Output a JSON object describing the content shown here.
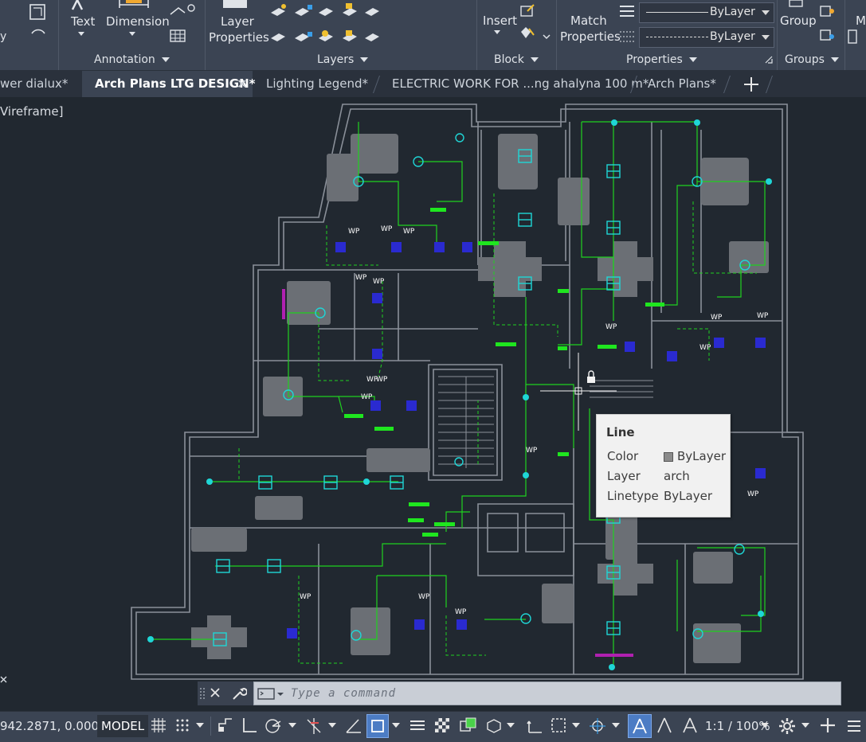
{
  "ribbon": {
    "text_label": "Text",
    "dimension_label": "Dimension",
    "layer_properties_line1": "Layer",
    "layer_properties_line2": "Properties",
    "insert_label": "Insert",
    "match_properties_line1": "Match",
    "match_properties_line2": "Properties",
    "bylayer_1": "ByLayer",
    "bylayer_2": "ByLayer",
    "group_label": "Group",
    "more_label": "M",
    "panels": [
      "Annotation",
      "Layers",
      "Block",
      "Properties",
      "Groups"
    ]
  },
  "tabs": [
    {
      "label": "wer dialux*"
    },
    {
      "label": "Arch Plans LTG DESIGN*",
      "active": true
    },
    {
      "label": "Lighting Legend*"
    },
    {
      "label": "ELECTRIC WORK FOR ...ng ahalyna 100 m*"
    },
    {
      "label": "Arch Plans*"
    }
  ],
  "viewport": {
    "label": "Vireframe]"
  },
  "tooltip": {
    "title": "Line",
    "color_key": "Color",
    "color_val": "ByLayer",
    "layer_key": "Layer",
    "layer_val": "arch",
    "linetype_key": "Linetype",
    "linetype_val": "ByLayer"
  },
  "command": {
    "placeholder": "Type a command"
  },
  "status": {
    "coords": "942.2871, 0.0000",
    "model": "MODEL",
    "scale": "1:1 / 100%"
  },
  "colors": {
    "ribbon": "#3b4453",
    "canvas": "#212830",
    "wall": "#8a9099",
    "circuit": "#1fd11f",
    "fixture": "#1fd6d6",
    "panel": "#2a2ad0",
    "furniture": "#6b6f75"
  },
  "icons": [
    "text-icon",
    "dimension-icon",
    "layer-icon",
    "insert-icon",
    "match-properties-icon",
    "group-icon",
    "grid-icon",
    "snap-icon",
    "osnap-icon",
    "gear-icon",
    "plus-icon",
    "wrench-icon",
    "close-icon",
    "terminal-icon"
  ]
}
